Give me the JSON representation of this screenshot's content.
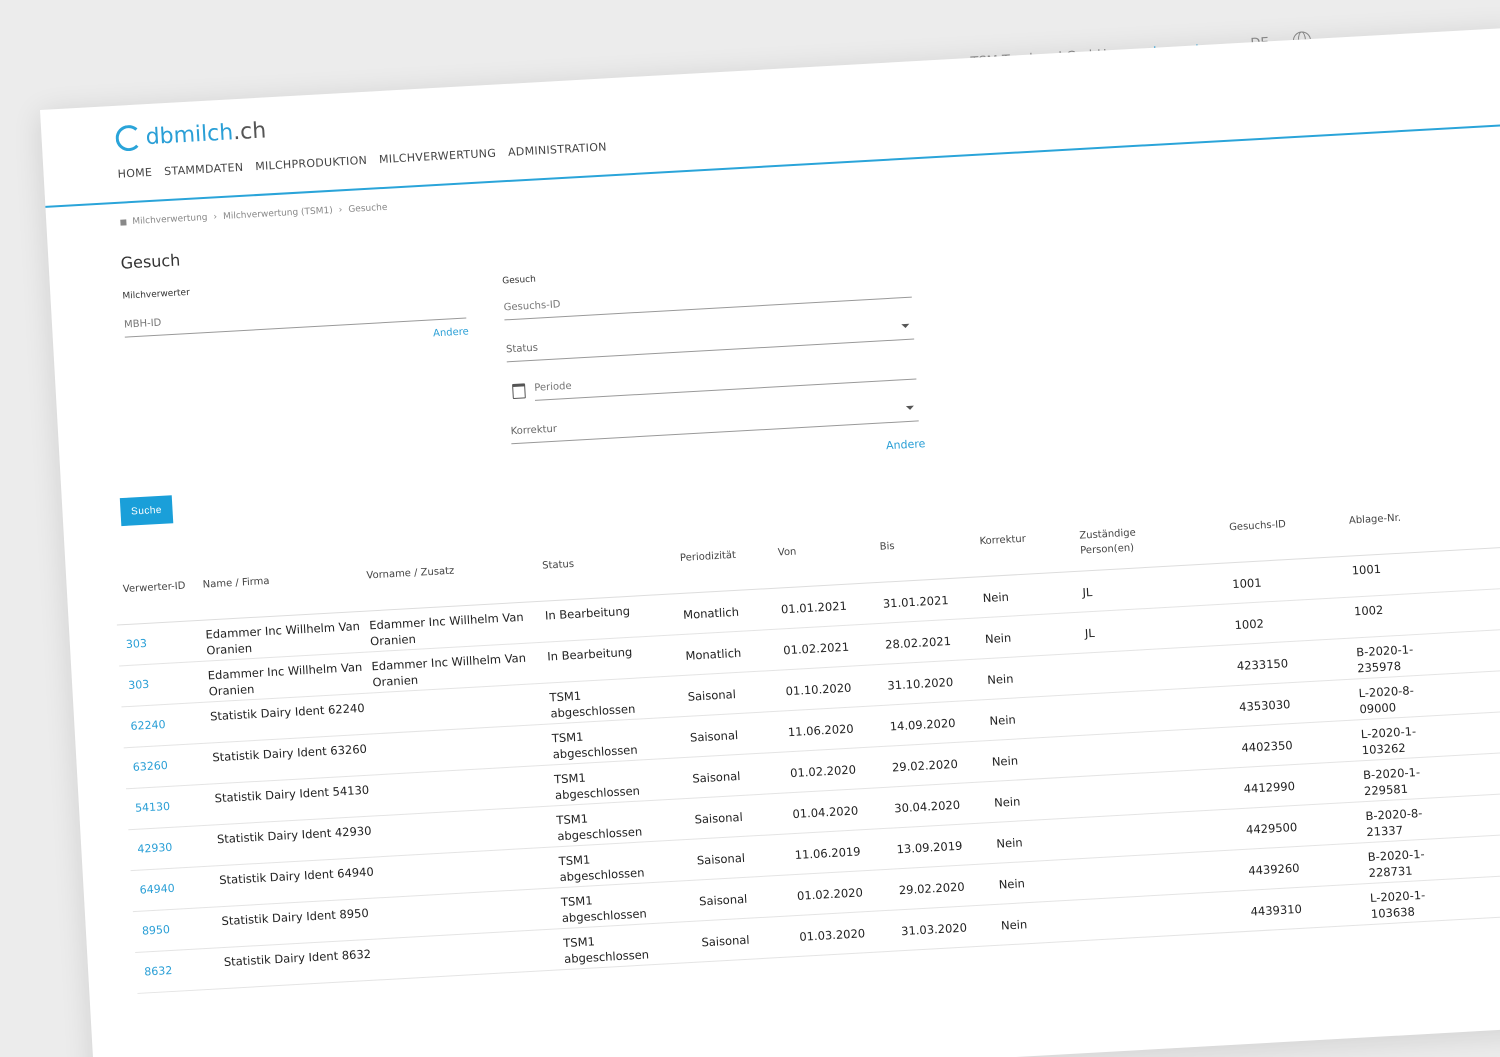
{
  "app": {
    "logo": {
      "brand": "dbmilch",
      "tld": ".ch"
    },
    "company": "TSM Treuhand GmbH",
    "logout_label": "Logout",
    "language": "DE",
    "more_label": "···"
  },
  "nav": {
    "items": [
      {
        "label": "HOME"
      },
      {
        "label": "STAMMDATEN"
      },
      {
        "label": "MILCHPRODUKTION"
      },
      {
        "label": "MILCHVERWERTUNG"
      },
      {
        "label": "ADMINISTRATION"
      }
    ]
  },
  "breadcrumb": {
    "items": [
      "Milchverwertung",
      "Milchverwertung (TSM1)",
      "Gesuche"
    ]
  },
  "page": {
    "title": "Gesuch"
  },
  "form": {
    "left": {
      "section_label": "Milchverwerter",
      "mbh_id_placeholder": "MBH-ID",
      "andere_label": "Andere"
    },
    "right": {
      "section_label": "Gesuch",
      "gesuchs_id_placeholder": "Gesuchs-ID",
      "status_placeholder": "Status",
      "periode_placeholder": "Periode",
      "korrektur_placeholder": "Korrektur",
      "andere_label": "Andere"
    },
    "search_label": "Suche"
  },
  "table": {
    "columns": [
      {
        "line1": "Verwerter-ID",
        "line2": ""
      },
      {
        "line1": "Name / Firma",
        "line2": ""
      },
      {
        "line1": "Vorname / Zusatz",
        "line2": ""
      },
      {
        "line1": "Status",
        "line2": ""
      },
      {
        "line1": "Periodizität",
        "line2": ""
      },
      {
        "line1": "Von",
        "line2": ""
      },
      {
        "line1": "Bis",
        "line2": ""
      },
      {
        "line1": "Korrektur",
        "line2": ""
      },
      {
        "line1": "Zuständige",
        "line2": "Person(en)"
      },
      {
        "line1": "Gesuchs-ID",
        "line2": ""
      },
      {
        "line1": "Ablage-Nr.",
        "line2": ""
      }
    ],
    "rows": [
      {
        "id": "303",
        "name1": "Edammer Inc Willhelm Van",
        "name2": "Oranien",
        "vorname1": "Edammer Inc Willhelm Van",
        "vorname2": "Oranien",
        "status1": "In Bearbeitung",
        "status2": "",
        "periodizitaet": "Monatlich",
        "von": "01.01.2021",
        "bis": "31.01.2021",
        "korrektur": "Nein",
        "person": "JL",
        "gesuchs_id": "1001",
        "ablage1": "1001",
        "ablage2": ""
      },
      {
        "id": "303",
        "name1": "Edammer Inc Willhelm Van",
        "name2": "Oranien",
        "vorname1": "Edammer Inc Willhelm Van",
        "vorname2": "Oranien",
        "status1": "In Bearbeitung",
        "status2": "",
        "periodizitaet": "Monatlich",
        "von": "01.02.2021",
        "bis": "28.02.2021",
        "korrektur": "Nein",
        "person": "JL",
        "gesuchs_id": "1002",
        "ablage1": "1002",
        "ablage2": ""
      },
      {
        "id": "62240",
        "name1": "Statistik Dairy Ident 62240",
        "name2": "",
        "vorname1": "",
        "vorname2": "",
        "status1": "TSM1",
        "status2": "abgeschlossen",
        "periodizitaet": "Saisonal",
        "von": "01.10.2020",
        "bis": "31.10.2020",
        "korrektur": "Nein",
        "person": "",
        "gesuchs_id": "4233150",
        "ablage1": "B-2020-1-",
        "ablage2": "235978"
      },
      {
        "id": "63260",
        "name1": "Statistik Dairy Ident 63260",
        "name2": "",
        "vorname1": "",
        "vorname2": "",
        "status1": "TSM1",
        "status2": "abgeschlossen",
        "periodizitaet": "Saisonal",
        "von": "11.06.2020",
        "bis": "14.09.2020",
        "korrektur": "Nein",
        "person": "",
        "gesuchs_id": "4353030",
        "ablage1": "L-2020-8-",
        "ablage2": "09000"
      },
      {
        "id": "54130",
        "name1": "Statistik Dairy Ident 54130",
        "name2": "",
        "vorname1": "",
        "vorname2": "",
        "status1": "TSM1",
        "status2": "abgeschlossen",
        "periodizitaet": "Saisonal",
        "von": "01.02.2020",
        "bis": "29.02.2020",
        "korrektur": "Nein",
        "person": "",
        "gesuchs_id": "4402350",
        "ablage1": "L-2020-1-",
        "ablage2": "103262"
      },
      {
        "id": "42930",
        "name1": "Statistik Dairy Ident 42930",
        "name2": "",
        "vorname1": "",
        "vorname2": "",
        "status1": "TSM1",
        "status2": "abgeschlossen",
        "periodizitaet": "Saisonal",
        "von": "01.04.2020",
        "bis": "30.04.2020",
        "korrektur": "Nein",
        "person": "",
        "gesuchs_id": "4412990",
        "ablage1": "B-2020-1-",
        "ablage2": "229581"
      },
      {
        "id": "64940",
        "name1": "Statistik Dairy Ident 64940",
        "name2": "",
        "vorname1": "",
        "vorname2": "",
        "status1": "TSM1",
        "status2": "abgeschlossen",
        "periodizitaet": "Saisonal",
        "von": "11.06.2019",
        "bis": "13.09.2019",
        "korrektur": "Nein",
        "person": "",
        "gesuchs_id": "4429500",
        "ablage1": "B-2020-8-",
        "ablage2": "21337"
      },
      {
        "id": "8950",
        "name1": "Statistik Dairy Ident 8950",
        "name2": "",
        "vorname1": "",
        "vorname2": "",
        "status1": "TSM1",
        "status2": "abgeschlossen",
        "periodizitaet": "Saisonal",
        "von": "01.02.2020",
        "bis": "29.02.2020",
        "korrektur": "Nein",
        "person": "",
        "gesuchs_id": "4439260",
        "ablage1": "B-2020-1-",
        "ablage2": "228731"
      },
      {
        "id": "8632",
        "name1": "Statistik Dairy Ident 8632",
        "name2": "",
        "vorname1": "",
        "vorname2": "",
        "status1": "TSM1",
        "status2": "abgeschlossen",
        "periodizitaet": "Saisonal",
        "von": "01.03.2020",
        "bis": "31.03.2020",
        "korrektur": "Nein",
        "person": "",
        "gesuchs_id": "4439310",
        "ablage1": "L-2020-1-",
        "ablage2": "103638"
      }
    ]
  }
}
